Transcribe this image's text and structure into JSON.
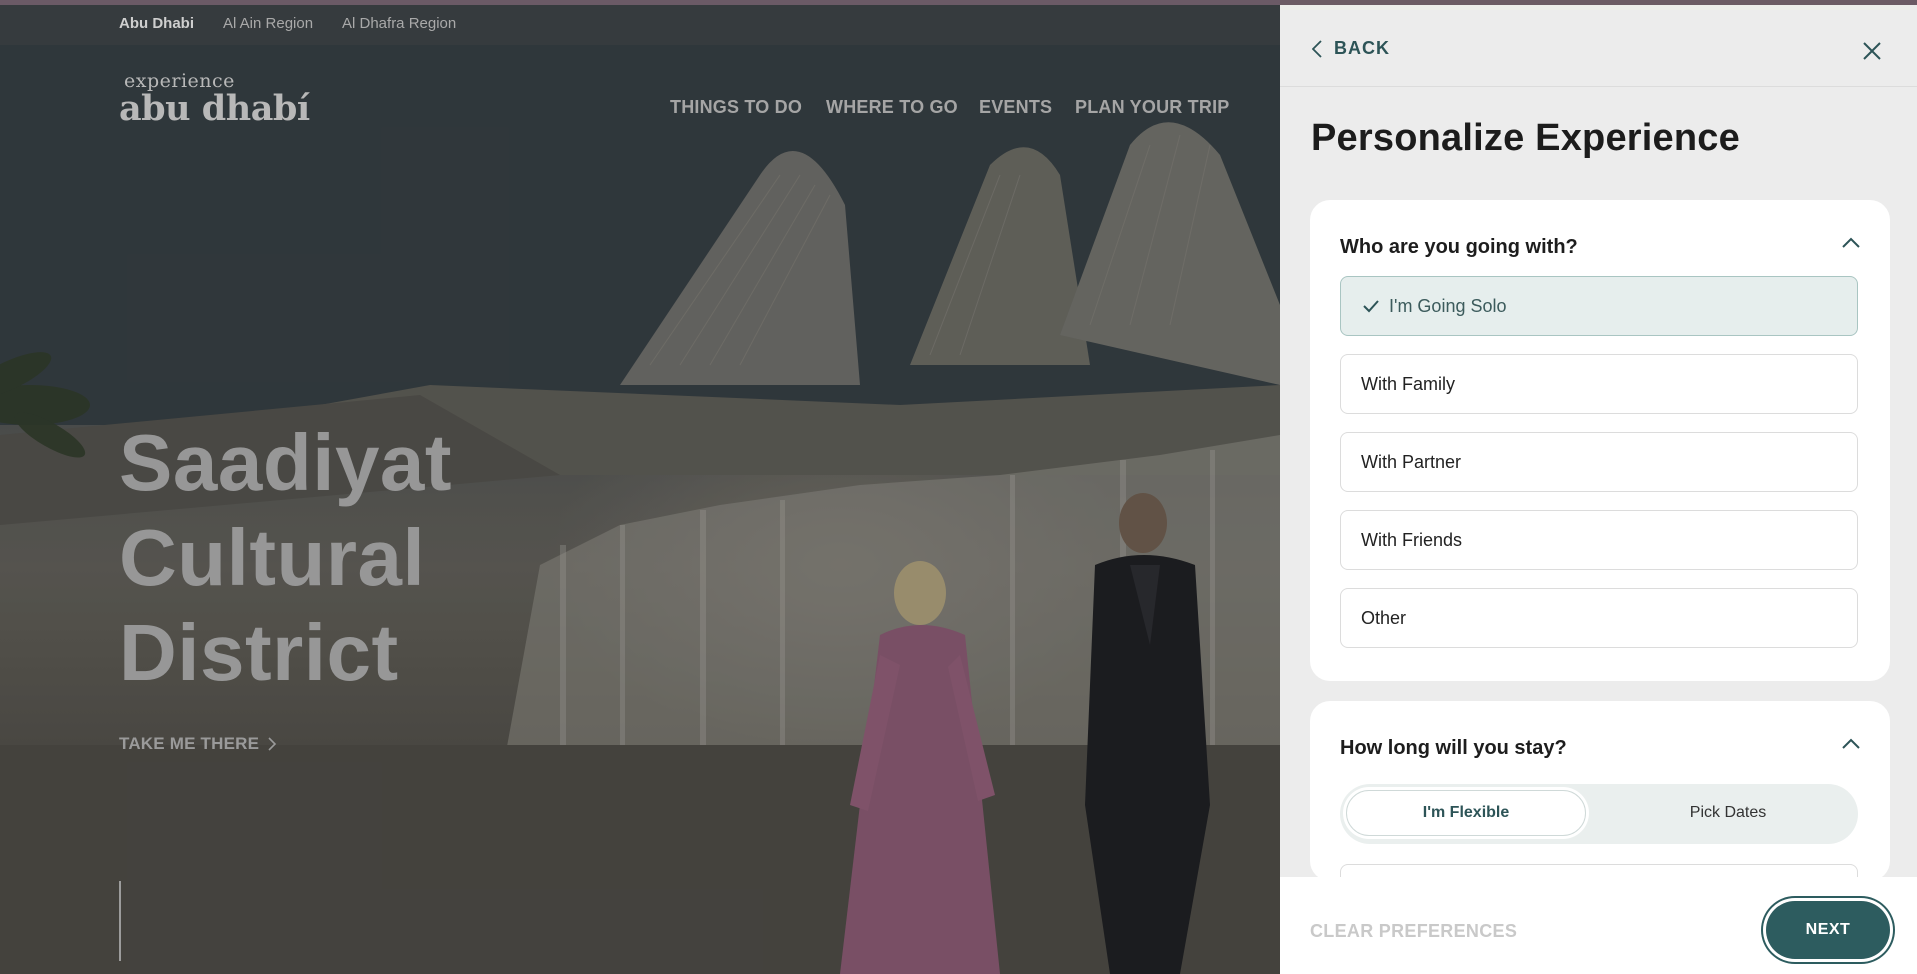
{
  "region_tabs": [
    "Abu Dhabi",
    "Al Ain Region",
    "Al Dhafra Region"
  ],
  "logo": {
    "line1": "experience",
    "line2": "abu dhabí"
  },
  "nav": [
    "THINGS TO DO",
    "WHERE TO GO",
    "EVENTS",
    "PLAN YOUR TRIP"
  ],
  "hero": {
    "title_lines": [
      "Saadiyat",
      "Cultural",
      "District"
    ],
    "cta": "TAKE ME THERE"
  },
  "panel": {
    "back_label": "BACK",
    "title": "Personalize Experience",
    "companions": {
      "question": "Who are you going with?",
      "options": [
        "I'm Going Solo",
        "With Family",
        "With Partner",
        "With Friends",
        "Other"
      ],
      "selected": "I'm Going Solo"
    },
    "stay": {
      "question": "How long will you stay?",
      "options": [
        "I'm Flexible",
        "Pick Dates"
      ],
      "selected": "I'm Flexible"
    },
    "clear_label": "CLEAR PREFERENCES",
    "next_label": "NEXT"
  },
  "colors": {
    "accent": "#2d5c5f",
    "selected_bg": "#e6eeed",
    "panel_bg": "#ececec"
  }
}
